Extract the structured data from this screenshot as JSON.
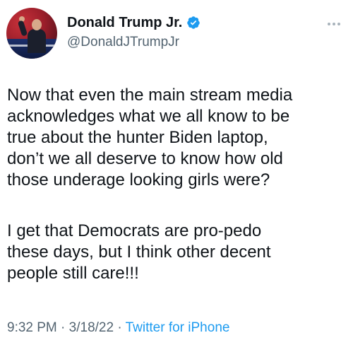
{
  "author": {
    "name": "Donald Trump Jr.",
    "handle": "@DonaldJTrumpJr",
    "verified_icon": "verified-badge-icon",
    "verified_color": "#1d9bf0"
  },
  "tweet": {
    "paragraph1": "Now that even the main stream media\nacknowledges what we all know to be\ntrue about the hunter Biden laptop,\ndon’t we all deserve to know how old\nthose underage looking girls were?",
    "paragraph2": "I get that Democrats are pro-pedo\nthese days, but I think other decent\npeople still care!!!"
  },
  "meta": {
    "time": "9:32 PM",
    "separator": " · ",
    "date": "3/18/22",
    "source": "Twitter for iPhone"
  }
}
